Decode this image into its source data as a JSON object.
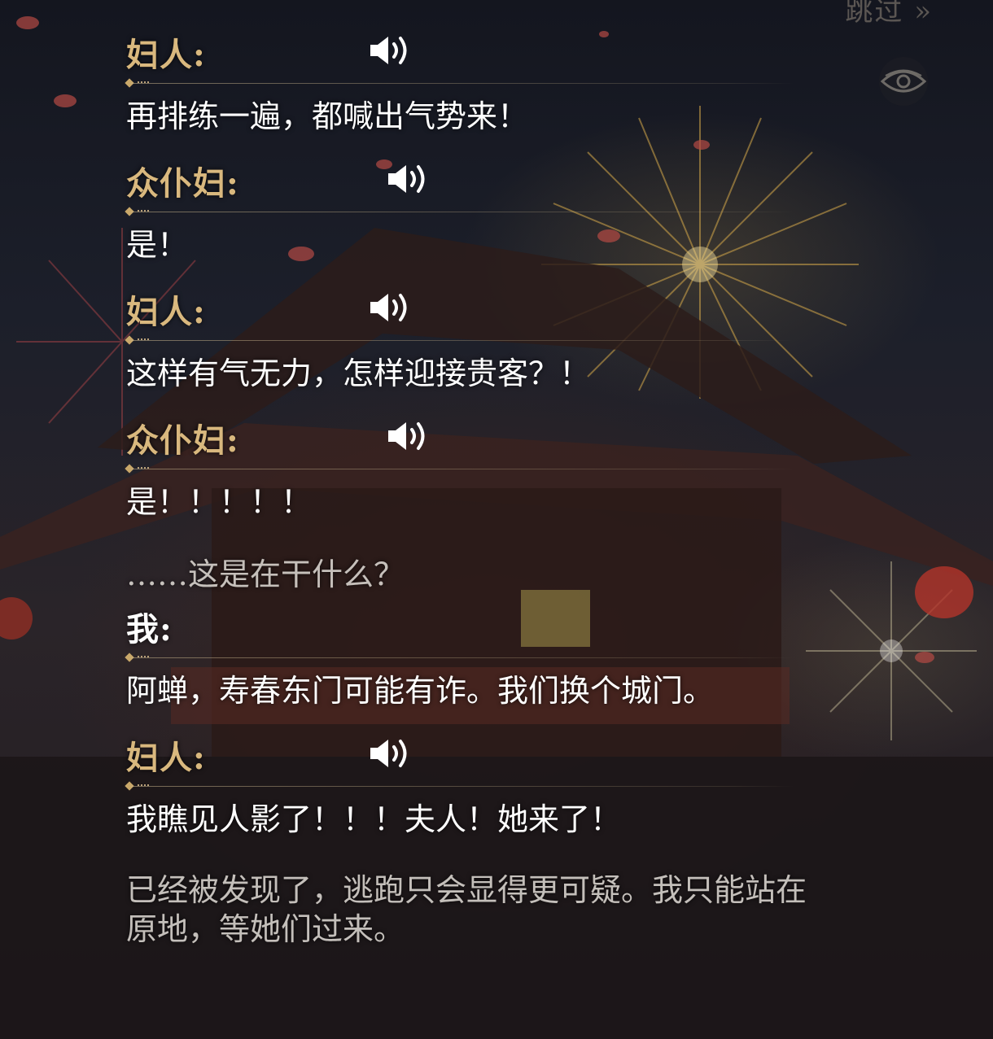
{
  "header": {
    "skip_label": "跳过 »",
    "eye_icon": "eye-icon"
  },
  "dialogue": {
    "entry1": {
      "speaker": "妇人:",
      "text": "再排练一遍，都喊出气势来！"
    },
    "entry2": {
      "speaker": "众仆妇:",
      "text": "是！"
    },
    "entry3": {
      "speaker": "妇人:",
      "text": "这样有气无力，怎样迎接贵客？！"
    },
    "entry4": {
      "speaker": "众仆妇:",
      "text": "是！！！！！"
    },
    "narration1": "……这是在干什么？",
    "entry5": {
      "speaker": "我:",
      "text": "阿蝉，寿春东门可能有诈。我们换个城门。"
    },
    "entry6": {
      "speaker": "妇人:",
      "text": "我瞧见人影了！！！夫人！她来了！"
    },
    "narration2_line1": "已经被发现了，逃跑只会显得更可疑。我只能站在",
    "narration2_line2": "原地，等她们过来。"
  },
  "colors": {
    "speaker_gold": "#d9b87e",
    "text_white": "#ffffff",
    "divider_gold": "#c9a86a"
  },
  "icons": {
    "voice": "speaker-volume-icon"
  }
}
